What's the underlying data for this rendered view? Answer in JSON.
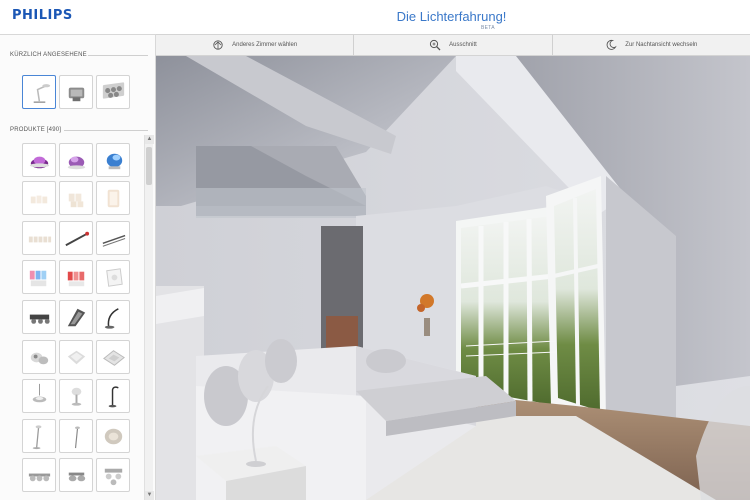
{
  "header": {
    "logo": "PHILIPS",
    "title": "Die Lichterfahrung!",
    "badge": "BETA"
  },
  "sidebar": {
    "recent_title": "KÜRZLICH ANGESEHENE",
    "products_title": "PRODUKTE [490]",
    "recent": [
      {
        "icon": "desk-lamp-icon"
      },
      {
        "icon": "wall-light-icon"
      },
      {
        "icon": "spotlight-panel-icon"
      }
    ],
    "products": [
      {
        "icon": "purple-livingcolors-icon"
      },
      {
        "icon": "blue-livingcolors-icon"
      },
      {
        "icon": "blue-orb-lamp-icon"
      },
      {
        "icon": "candle-lights-icon"
      },
      {
        "icon": "candle-set-icon"
      },
      {
        "icon": "glass-candle-icon"
      },
      {
        "icon": "tealight-row-icon"
      },
      {
        "icon": "rod-light-icon"
      },
      {
        "icon": "rod-light-long-icon"
      },
      {
        "icon": "color-cups-icon"
      },
      {
        "icon": "red-cups-icon"
      },
      {
        "icon": "white-tile-light-icon"
      },
      {
        "icon": "spot-bar-icon"
      },
      {
        "icon": "wave-lamp-icon"
      },
      {
        "icon": "arc-desk-lamp-icon"
      },
      {
        "icon": "spot-cluster-icon"
      },
      {
        "icon": "round-ceiling-icon"
      },
      {
        "icon": "square-ceiling-icon"
      },
      {
        "icon": "pendant-lamp-icon"
      },
      {
        "icon": "table-lamp-icon"
      },
      {
        "icon": "reading-lamp-icon"
      },
      {
        "icon": "floor-lamp-icon"
      },
      {
        "icon": "floor-lamp-thin-icon"
      },
      {
        "icon": "flat-ceiling-icon"
      },
      {
        "icon": "triple-spot-icon"
      },
      {
        "icon": "double-spot-icon"
      },
      {
        "icon": "quad-spot-icon"
      }
    ]
  },
  "toolbar": {
    "items": [
      {
        "label": "Anderes Zimmer wählen",
        "icon": "room-select-icon"
      },
      {
        "label": "Ausschnitt",
        "icon": "zoom-icon"
      },
      {
        "label": "Zur Nachtansicht wechseln",
        "icon": "moon-icon"
      }
    ]
  },
  "colors": {
    "brand": "#1b57b5",
    "title": "#3a78c9",
    "selected_border": "#4a86d6"
  }
}
